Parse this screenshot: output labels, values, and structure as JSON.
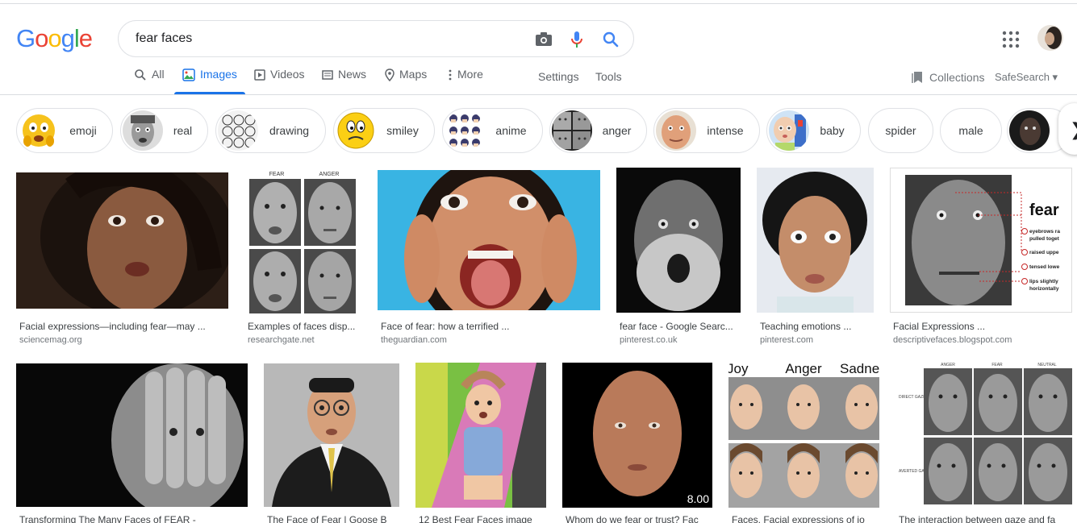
{
  "search": {
    "query": "fear faces"
  },
  "logo": {
    "letters": [
      "G",
      "o",
      "o",
      "g",
      "l",
      "e"
    ],
    "colors": [
      "#4285F4",
      "#EA4335",
      "#FBBC05",
      "#4285F4",
      "#34A853",
      "#EA4335"
    ]
  },
  "tabs": [
    {
      "label": "All",
      "icon": "search-icon",
      "active": false
    },
    {
      "label": "Images",
      "icon": "image-icon",
      "active": true
    },
    {
      "label": "Videos",
      "icon": "play-icon",
      "active": false
    },
    {
      "label": "News",
      "icon": "news-icon",
      "active": false
    },
    {
      "label": "Maps",
      "icon": "pin-icon",
      "active": false
    },
    {
      "label": "More",
      "icon": "dots-icon",
      "active": false
    }
  ],
  "tools": {
    "settings": "Settings",
    "tools": "Tools"
  },
  "right_tools": {
    "collections": "Collections",
    "safesearch": "SafeSearch ▾"
  },
  "chips": [
    {
      "label": "emoji"
    },
    {
      "label": "real"
    },
    {
      "label": "drawing"
    },
    {
      "label": "smiley"
    },
    {
      "label": "anime"
    },
    {
      "label": "anger"
    },
    {
      "label": "intense"
    },
    {
      "label": "baby"
    },
    {
      "label": "spider"
    },
    {
      "label": "male"
    }
  ],
  "results_row1": [
    {
      "caption": "Facial expressions—including fear—may ...",
      "source": "sciencemag.org"
    },
    {
      "caption": "Examples of faces disp...",
      "source": "researchgate.net",
      "labels": [
        "FEAR",
        "ANGER"
      ]
    },
    {
      "caption": "Face of fear: how a terrified ...",
      "source": "theguardian.com"
    },
    {
      "caption": "fear face - Google Searc...",
      "source": "pinterest.co.uk"
    },
    {
      "caption": "Teaching emotions ...",
      "source": "pinterest.com"
    },
    {
      "caption": "Facial Expressions ...",
      "source": "descriptivefaces.blogspot.com",
      "labels": [
        "fear",
        "eyebrows ra",
        "pulled toget",
        "raised uppe",
        "tensed lowe",
        "lips slightly",
        "horizontally"
      ]
    }
  ],
  "results_row2": [
    {
      "caption": "Transforming The Many Faces of FEAR -",
      "source": ""
    },
    {
      "caption": "The Face of Fear | Goose B",
      "source": ""
    },
    {
      "caption": "12 Best Fear Faces image",
      "source": ""
    },
    {
      "caption": "Whom do we fear or trust? Fac",
      "source": "",
      "badge": "8.00"
    },
    {
      "caption": "Faces, Facial expressions of jo",
      "source": "",
      "labels": [
        "Joy",
        "Anger",
        "Sadne"
      ]
    },
    {
      "caption": "The interaction between gaze and fa",
      "source": "",
      "labels": [
        "ANGER",
        "FEAR",
        "NEUTRAL",
        "DIRECT GAZE",
        "AVERTED GAZE"
      ]
    }
  ]
}
